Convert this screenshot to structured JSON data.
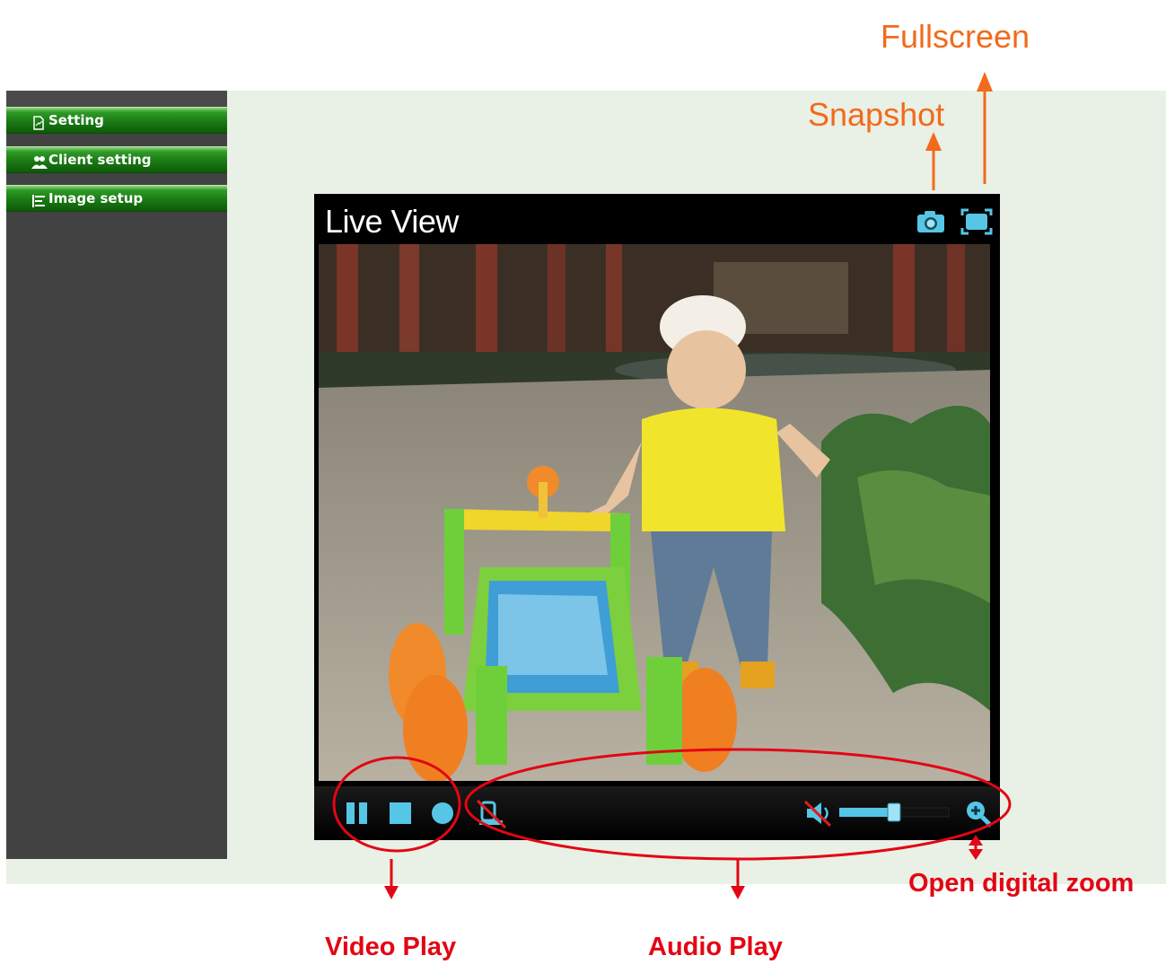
{
  "sidebar": {
    "items": [
      {
        "label": "Setting",
        "icon": "document-icon"
      },
      {
        "label": "Client setting",
        "icon": "users-icon"
      },
      {
        "label": "Image setup",
        "icon": "image-setup-icon"
      }
    ]
  },
  "player": {
    "title": "Live View",
    "top_icons": [
      "camera-icon",
      "fullscreen-icon"
    ],
    "controls": [
      "pause-icon",
      "stop-icon",
      "record-icon",
      "microphone-muted-icon",
      "speaker-muted-icon",
      "volume-slider",
      "zoom-in-icon"
    ],
    "volume_level": 0.5
  },
  "annotations": {
    "fullscreen": "Fullscreen",
    "snapshot": "Snapshot",
    "video_play": "Video Play",
    "audio_play": "Audio Play",
    "digital_zoom": "Open digital zoom"
  },
  "colors": {
    "annotation_orange": "#f26a1b",
    "annotation_red": "#e30613",
    "menu_green": "#1a7a14",
    "icon_blue": "#56c6e6"
  }
}
